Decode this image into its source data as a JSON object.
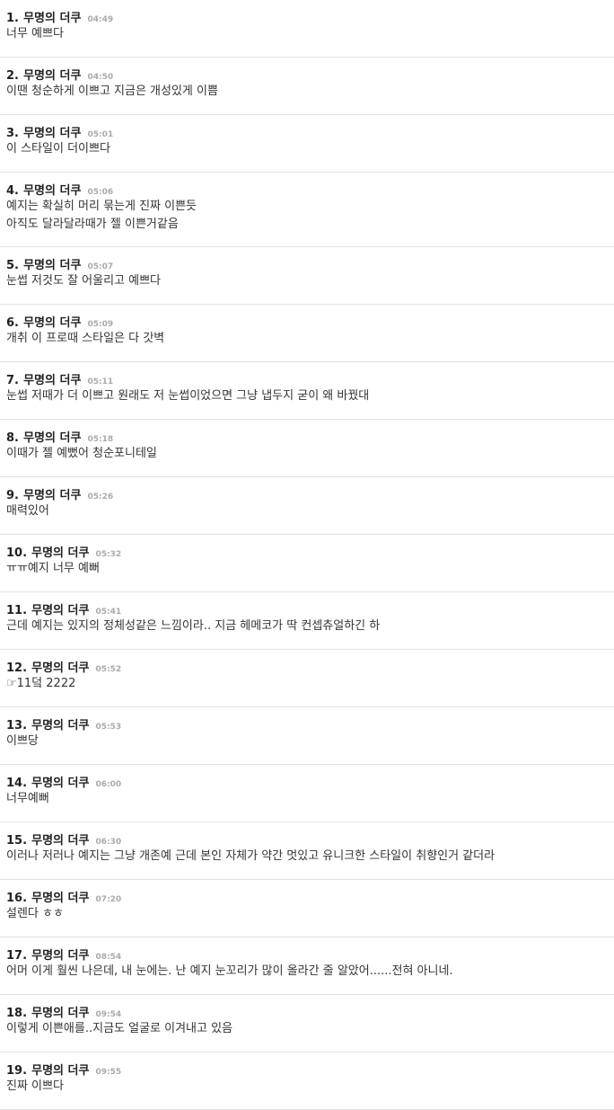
{
  "comments": [
    {
      "num": "1.",
      "name": "무명의 더쿠",
      "time": "04:49",
      "lines": [
        "너무 예쁘다"
      ]
    },
    {
      "num": "2.",
      "name": "무명의 더쿠",
      "time": "04:50",
      "lines": [
        "이땐 청순하게 이쁘고 지금은 개성있게 이쁨"
      ]
    },
    {
      "num": "3.",
      "name": "무명의 더쿠",
      "time": "05:01",
      "lines": [
        "이 스타일이 더이쁘다"
      ]
    },
    {
      "num": "4.",
      "name": "무명의 더쿠",
      "time": "05:06",
      "lines": [
        "예지는 확실히 머리 묶는게 진짜 이쁜듯",
        "아직도 달라달라때가 젤 이쁜거같음"
      ]
    },
    {
      "num": "5.",
      "name": "무명의 더쿠",
      "time": "05:07",
      "lines": [
        "눈썹 저것도 잘 어울리고 예쁘다"
      ]
    },
    {
      "num": "6.",
      "name": "무명의 더쿠",
      "time": "05:09",
      "lines": [
        "개취 이 프로때 스타일은 다 갓벽"
      ]
    },
    {
      "num": "7.",
      "name": "무명의 더쿠",
      "time": "05:11",
      "lines": [
        "눈썹 저때가 더 이쁘고 원래도 저 눈썹이었으면 그냥 냅두지 굳이 왜 바꿨대"
      ]
    },
    {
      "num": "8.",
      "name": "무명의 더쿠",
      "time": "05:18",
      "lines": [
        "이때가 젤 예뻤어 청순포니테일"
      ]
    },
    {
      "num": "9.",
      "name": "무명의 더쿠",
      "time": "05:26",
      "lines": [
        "매력있어"
      ]
    },
    {
      "num": "10.",
      "name": "무명의 더쿠",
      "time": "05:32",
      "lines": [
        "ㅠㅠ예지 너무 예뻐"
      ]
    },
    {
      "num": "11.",
      "name": "무명의 더쿠",
      "time": "05:41",
      "lines": [
        "근데 예지는 있지의 정체성같은 느낌이라.. 지금 헤메코가 딱 컨셉츄얼하긴 하"
      ]
    },
    {
      "num": "12.",
      "name": "무명의 더쿠",
      "time": "05:52",
      "lines": [
        "☞11덬 2222"
      ]
    },
    {
      "num": "13.",
      "name": "무명의 더쿠",
      "time": "05:53",
      "lines": [
        "이쁘당"
      ]
    },
    {
      "num": "14.",
      "name": "무명의 더쿠",
      "time": "06:00",
      "lines": [
        "너무예뻐"
      ]
    },
    {
      "num": "15.",
      "name": "무명의 더쿠",
      "time": "06:30",
      "lines": [
        "이러나 저러나 예지는 그냥 개존예 근데 본인 자체가 약간 멋있고 유니크한 스타일이 취향인거 같더라"
      ]
    },
    {
      "num": "16.",
      "name": "무명의 더쿠",
      "time": "07:20",
      "lines": [
        "설렌다 ㅎㅎ"
      ]
    },
    {
      "num": "17.",
      "name": "무명의 더쿠",
      "time": "08:54",
      "lines": [
        "어머 이게 훨씬 나은데, 내 눈에는. 난 예지 눈꼬리가 많이 올라간 줄 알았어......전혀 아니네."
      ]
    },
    {
      "num": "18.",
      "name": "무명의 더쿠",
      "time": "09:54",
      "lines": [
        "이렇게 이쁜애를..지금도 얼굴로 이겨내고 있음"
      ]
    },
    {
      "num": "19.",
      "name": "무명의 더쿠",
      "time": "09:55",
      "lines": [
        "진짜 이쁘다"
      ]
    }
  ]
}
